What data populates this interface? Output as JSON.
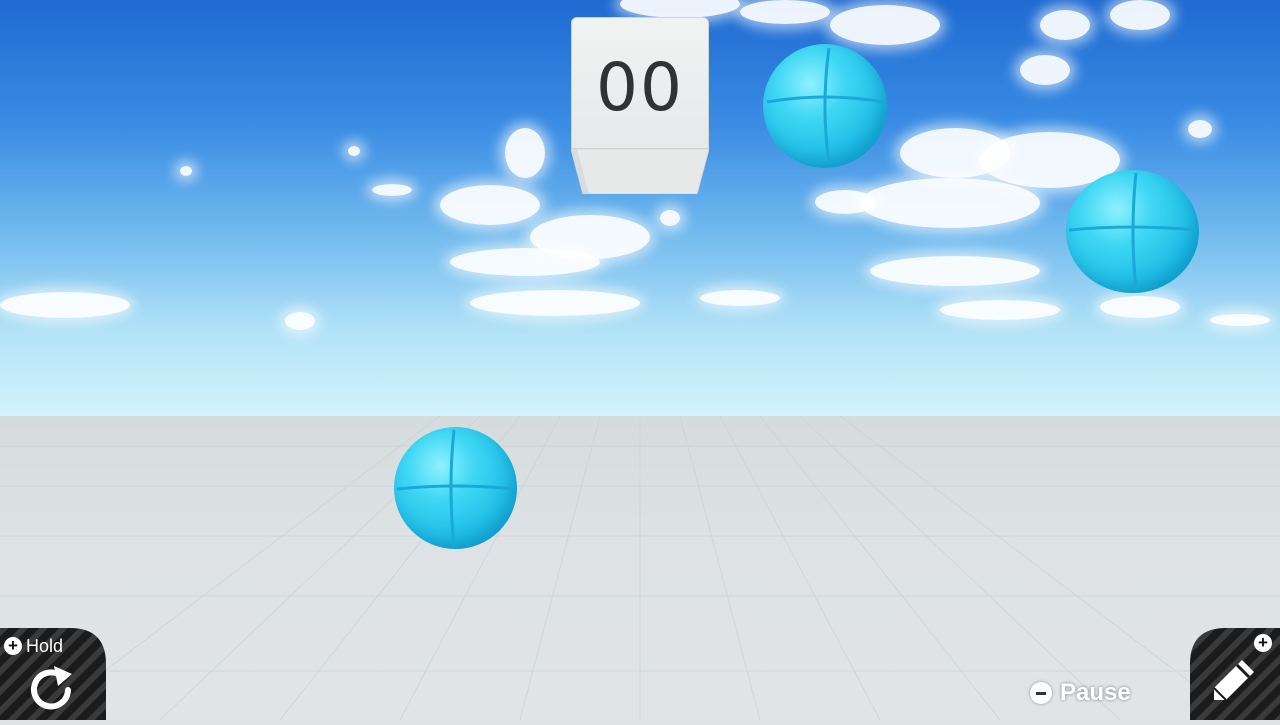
{
  "score": {
    "value": "00"
  },
  "hud": {
    "hold_label": "Hold",
    "pause_label": "Pause"
  },
  "icons": {
    "hold_button": "plus-icon",
    "hold_action": "rotate-icon",
    "edit_button": "plus-icon",
    "edit_action": "pencil-icon",
    "pause_button": "minus-icon"
  },
  "colors": {
    "ball": "#2ecbee",
    "sky_top": "#1e6ad2",
    "sky_horizon": "#d3f3fb",
    "floor": "#dfe3e6",
    "score_block": "#eceeee",
    "score_text": "#303234"
  },
  "scene": {
    "ball_count": 3
  }
}
